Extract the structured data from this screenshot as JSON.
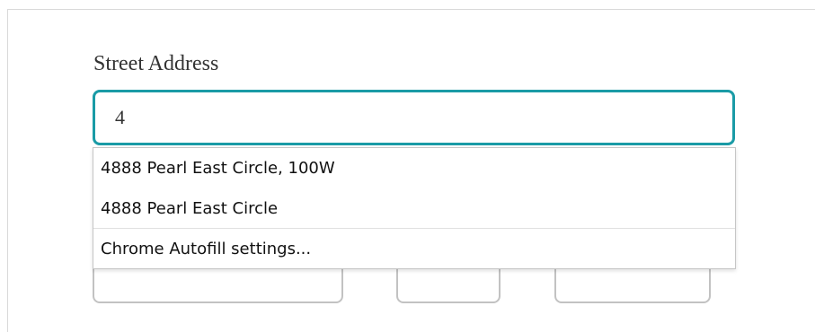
{
  "form": {
    "street_label": "Street Address",
    "street_value": "4"
  },
  "autofill": {
    "suggestions": [
      "4888 Pearl East Circle, 100W",
      "4888 Pearl East Circle"
    ],
    "settings_label": "Chrome Autofill settings..."
  },
  "colors": {
    "focus_border": "#1a9ba6",
    "field_border": "#c2c2c2"
  }
}
